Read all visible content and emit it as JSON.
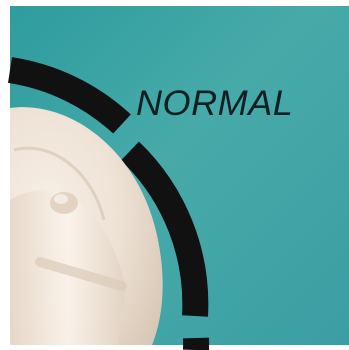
{
  "dial": {
    "setting_label": "NORMAL"
  },
  "colors": {
    "panel_teal": "#3fa6a6",
    "scale_black": "#111111",
    "knob_cream": "#efe5da",
    "frame_white": "#ffffff"
  }
}
